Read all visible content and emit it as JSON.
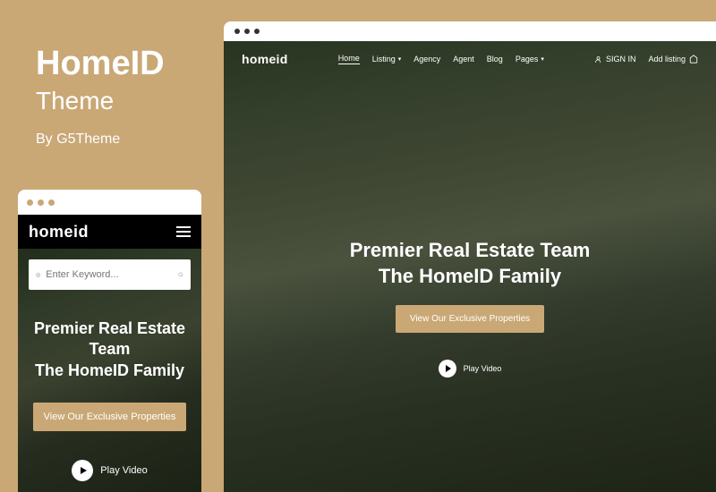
{
  "title": {
    "main": "HomeID",
    "sub": "Theme",
    "by": "By G5Theme"
  },
  "logo": "homeid",
  "hero": {
    "line1": "Premier Real Estate Team",
    "line2": "The HomeID Family",
    "cta": "View Our Exclusive Properties",
    "play": "Play Video"
  },
  "search": {
    "placeholder": "Enter Keyword..."
  },
  "nav": {
    "items": [
      "Home",
      "Listing",
      "Agency",
      "Agent",
      "Blog",
      "Pages"
    ],
    "signin": "SIGN IN",
    "addlisting": "Add listing"
  },
  "colors": {
    "accent": "#c9a876"
  }
}
